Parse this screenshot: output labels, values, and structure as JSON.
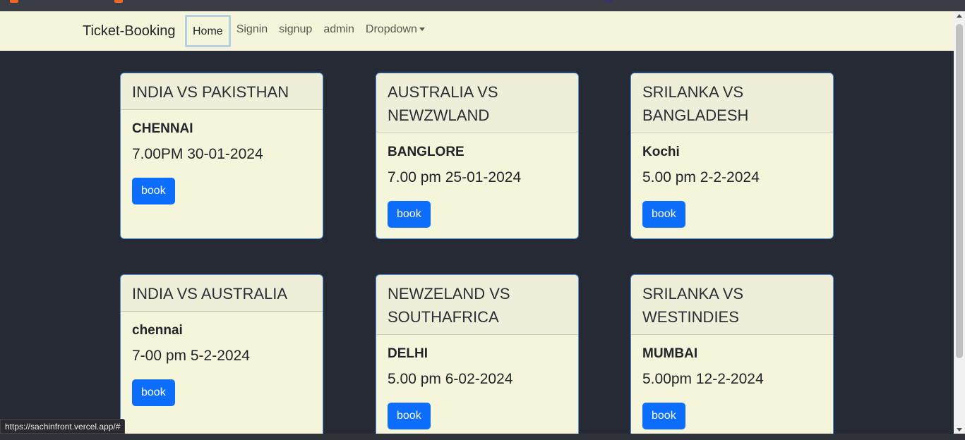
{
  "app": {
    "brand": "Ticket-Booking"
  },
  "nav": {
    "items": [
      {
        "label": "Home",
        "active": true
      },
      {
        "label": "Signin"
      },
      {
        "label": "signup"
      },
      {
        "label": "admin"
      },
      {
        "label": "Dropdown"
      }
    ]
  },
  "matches": [
    {
      "title": "INDIA VS PAKISTHAN",
      "venue": "CHENNAI",
      "time": "7.00PM 30-01-2024",
      "button": "book"
    },
    {
      "title": "AUSTRALIA VS NEWZWLAND",
      "venue": "BANGLORE",
      "time": "7.00 pm 25-01-2024",
      "button": "book"
    },
    {
      "title": "SRILANKA VS BANGLADESH",
      "venue": "Kochi",
      "time": "5.00 pm 2-2-2024",
      "button": "book"
    },
    {
      "title": "INDIA VS AUSTRALIA",
      "venue": "chennai",
      "time": "7-00 pm 5-2-2024",
      "button": "book"
    },
    {
      "title": "NEWZELAND VS SOUTHAFRICA",
      "venue": "DELHI",
      "time": "5.00 pm 6-02-2024",
      "button": "book"
    },
    {
      "title": "SRILANKA VS WESTINDIES",
      "venue": "MUMBAI",
      "time": "5.00pm 12-2-2024",
      "button": "book"
    }
  ],
  "status": {
    "url": "https://sachinfront.vercel.app/#"
  },
  "colors": {
    "navbar_bg": "#f5f5dc",
    "page_bg": "#262a34",
    "button_bg": "#0d6efd",
    "card_border": "#4a90e2"
  }
}
